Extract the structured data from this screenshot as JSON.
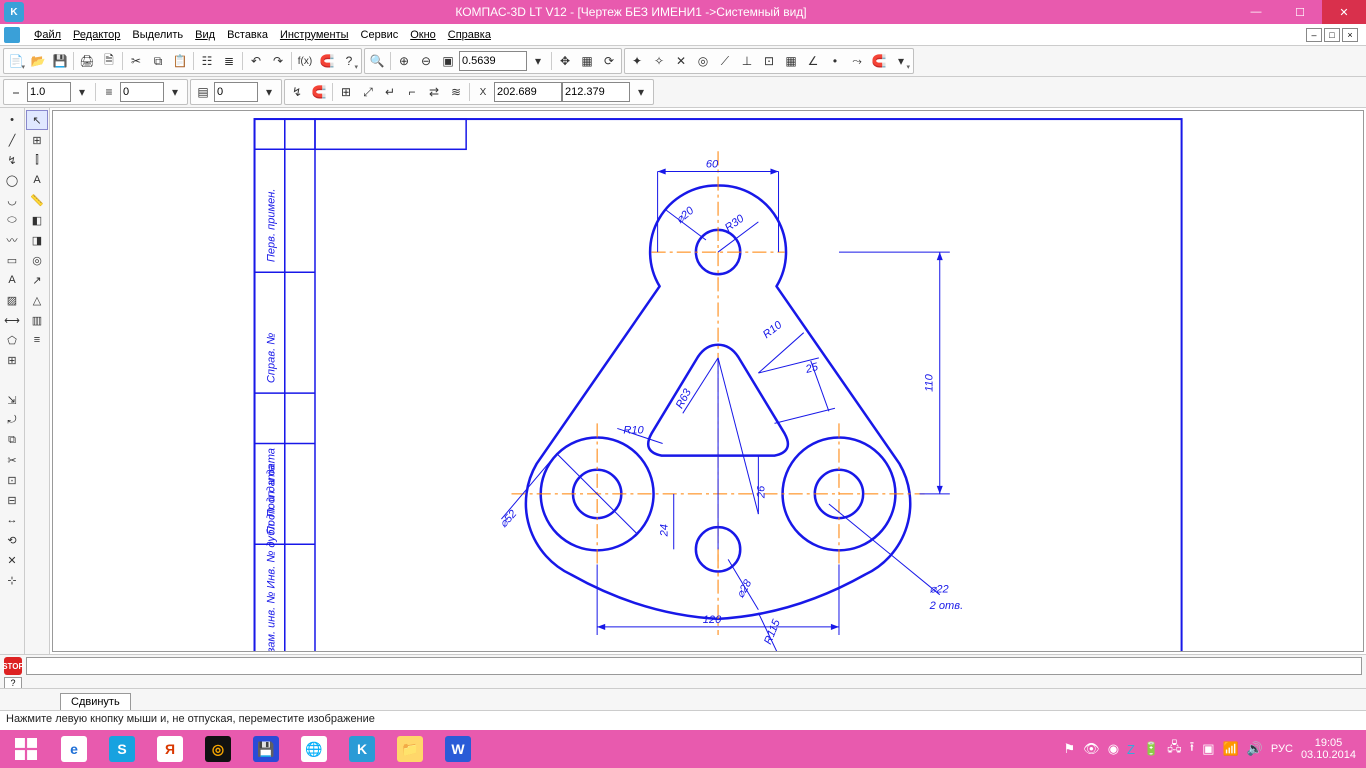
{
  "window": {
    "app_title": "КОМПАС-3D LT V12 - [Чертеж БЕЗ ИМЕНИ1 ->Системный вид]"
  },
  "menu": {
    "file": "Файл",
    "editor": "Редактор",
    "select": "Выделить",
    "view": "Вид",
    "insert": "Вставка",
    "tools": "Инструменты",
    "service": "Сервис",
    "window": "Окно",
    "help": "Справка"
  },
  "toolbar": {
    "zoom": "0.5639",
    "line_w": "1.0",
    "style": "0",
    "layer": "0",
    "coord_x": "202.689",
    "coord_y": "212.379"
  },
  "bottom": {
    "tab": "Сдвинуть"
  },
  "status": {
    "hint": "Нажмите левую кнопку мыши и, не отпуская, переместите изображение"
  },
  "taskbar": {
    "lang": "РУС",
    "time": "19:05",
    "date": "03.10.2014"
  },
  "drawing": {
    "dims": {
      "d60": "60",
      "r30": "R30",
      "d20": "⌀20",
      "r10a": "R10",
      "d25": "25",
      "r63": "R63",
      "r10b": "R10",
      "h110": "110",
      "d52": "⌀52",
      "d24": "24",
      "d26": "26",
      "d120": "120",
      "d28": "⌀28",
      "r115": "R115",
      "d22": "⌀22",
      "otv": "2 отв."
    },
    "stamp": {
      "a": "Перв. примен.",
      "b": "Справ. №",
      "c": "Подп. и дата",
      "d": "Взам. инв. № Инв. № дубл. Подп. и дата"
    }
  }
}
